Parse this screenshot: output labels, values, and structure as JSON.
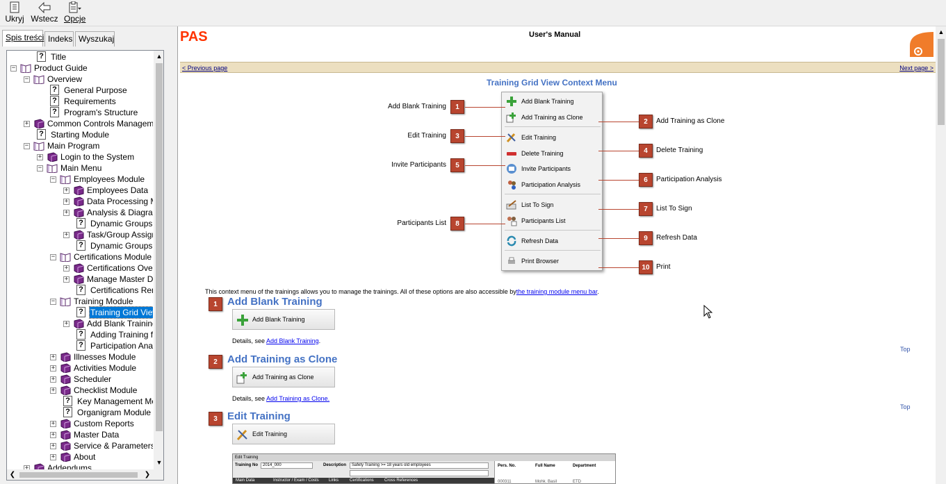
{
  "toolbar": {
    "hide_label": "Ukryj",
    "back_label": "Wstecz",
    "options_label": "Opcje"
  },
  "nav_tabs": [
    "Spis treści",
    "Indeks",
    "Wyszukaj"
  ],
  "tree": [
    {
      "label": "Title",
      "icon": "help-page-icon",
      "expander": "",
      "level": 1
    },
    {
      "label": "Product Guide",
      "icon": "open-book-icon",
      "expander": "-",
      "level": 0
    },
    {
      "label": "Overview",
      "icon": "open-book-icon",
      "expander": "-",
      "level": 1
    },
    {
      "label": "General Purpose",
      "icon": "help-page-icon",
      "expander": "",
      "level": 3
    },
    {
      "label": "Requirements",
      "icon": "help-page-icon",
      "expander": "",
      "level": 3
    },
    {
      "label": "Program's Structure",
      "icon": "help-page-icon",
      "expander": "",
      "level": 3
    },
    {
      "label": "Common Controls Management",
      "icon": "closed-book-icon",
      "expander": "+",
      "level": 1
    },
    {
      "label": "Starting Module",
      "icon": "help-page-icon",
      "expander": "",
      "level": 2
    },
    {
      "label": "Main Program",
      "icon": "open-book-icon",
      "expander": "-",
      "level": 1
    },
    {
      "label": "Login to the System",
      "icon": "closed-book-icon",
      "expander": "+",
      "level": 2
    },
    {
      "label": "Main Menu",
      "icon": "open-book-icon",
      "expander": "-",
      "level": 2
    },
    {
      "label": "Employees Module",
      "icon": "open-book-icon",
      "expander": "-",
      "level": 3
    },
    {
      "label": "Employees Data",
      "icon": "closed-book-icon",
      "expander": "+",
      "level": 4
    },
    {
      "label": "Data Processing Mo",
      "icon": "closed-book-icon",
      "expander": "+",
      "level": 4
    },
    {
      "label": "Analysis & Diagrams",
      "icon": "closed-book-icon",
      "expander": "+",
      "level": 4
    },
    {
      "label": "Dynamic Groups",
      "icon": "help-page-icon",
      "expander": "",
      "level": 5
    },
    {
      "label": "Task/Group Assign",
      "icon": "closed-book-icon",
      "expander": "+",
      "level": 4
    },
    {
      "label": "Dynamic Groups Mo",
      "icon": "help-page-icon",
      "expander": "",
      "level": 5
    },
    {
      "label": "Certifications Module",
      "icon": "open-book-icon",
      "expander": "-",
      "level": 3
    },
    {
      "label": "Certifications Overv",
      "icon": "closed-book-icon",
      "expander": "+",
      "level": 4
    },
    {
      "label": "Manage Master Dat",
      "icon": "closed-book-icon",
      "expander": "+",
      "level": 4
    },
    {
      "label": "Certifications Remin",
      "icon": "help-page-icon",
      "expander": "",
      "level": 5
    },
    {
      "label": "Training Module",
      "icon": "open-book-icon",
      "expander": "-",
      "level": 3
    },
    {
      "label": "Training Grid View C",
      "icon": "help-page-icon",
      "expander": "",
      "level": 5,
      "selected": true
    },
    {
      "label": "Add Blank Training",
      "icon": "closed-book-icon",
      "expander": "+",
      "level": 4
    },
    {
      "label": "Adding Training fron",
      "icon": "help-page-icon",
      "expander": "",
      "level": 5
    },
    {
      "label": "Participation Analys",
      "icon": "help-page-icon",
      "expander": "",
      "level": 5
    },
    {
      "label": "Illnesses Module",
      "icon": "closed-book-icon",
      "expander": "+",
      "level": 3
    },
    {
      "label": "Activities Module",
      "icon": "closed-book-icon",
      "expander": "+",
      "level": 3
    },
    {
      "label": "Scheduler",
      "icon": "closed-book-icon",
      "expander": "+",
      "level": 3
    },
    {
      "label": "Checklist Module",
      "icon": "closed-book-icon",
      "expander": "+",
      "level": 3
    },
    {
      "label": "Key Management Modu",
      "icon": "help-page-icon",
      "expander": "",
      "level": 4
    },
    {
      "label": "Organigram Module",
      "icon": "help-page-icon",
      "expander": "",
      "level": 4
    },
    {
      "label": "Custom Reports",
      "icon": "closed-book-icon",
      "expander": "+",
      "level": 3
    },
    {
      "label": "Master Data",
      "icon": "closed-book-icon",
      "expander": "+",
      "level": 3
    },
    {
      "label": "Service & Parameters",
      "icon": "closed-book-icon",
      "expander": "+",
      "level": 3
    },
    {
      "label": "About",
      "icon": "closed-book-icon",
      "expander": "+",
      "level": 3
    },
    {
      "label": "Addendums",
      "icon": "closed-book-icon",
      "expander": "+",
      "level": 1
    }
  ],
  "header": {
    "brand": "PAS",
    "manual_title": "User's Manual",
    "prev": "< Previous page",
    "next": "Next page >"
  },
  "page": {
    "title": "Training Grid View Context Menu",
    "callouts_left": [
      {
        "n": "1",
        "label": "Add Blank Training"
      },
      {
        "n": "3",
        "label": "Edit Training"
      },
      {
        "n": "5",
        "label": "Invite Participants"
      },
      {
        "n": "8",
        "label": "Participants List"
      }
    ],
    "callouts_right": [
      {
        "n": "2",
        "label": "Add Training as Clone"
      },
      {
        "n": "4",
        "label": "Delete Training"
      },
      {
        "n": "6",
        "label": "Participation Analysis"
      },
      {
        "n": "7",
        "label": "List To Sign"
      },
      {
        "n": "9",
        "label": "Refresh Data"
      },
      {
        "n": "10",
        "label": "Print"
      }
    ],
    "menu_items": [
      "Add Blank Training",
      "Add Training as Clone",
      "Edit Training",
      "Delete Training",
      "Invite Participants",
      "Participation Analysis",
      "List To Sign",
      "Participants List",
      "Refresh Data",
      "Print Browser"
    ],
    "intro": "This context menu of the trainings allows you to manage the trainings. All of these options are also accessible by",
    "intro_link": "the training module menu bar",
    "intro_end": ".",
    "details_prefix": "Details, see",
    "top_label": "Top",
    "sections": [
      {
        "n": "1",
        "title": "Add Blank Training",
        "button": "Add Blank Training",
        "link": "Add Blank Training",
        "suffix": "."
      },
      {
        "n": "2",
        "title": "Add Training as Clone",
        "button": "Add Training as Clone",
        "link": "Add Training as Clone.",
        "suffix": ""
      },
      {
        "n": "3",
        "title": "Edit Training",
        "button": "Edit Training"
      }
    ],
    "screenshot": {
      "window_title": "Edit Training",
      "training_no_label": "Training No",
      "training_no_value": "2014_000",
      "description_label": "Description",
      "description_value": "Safety Training >= 18 years old employees",
      "col_pers": "Pers. No.",
      "col_name": "Full Name",
      "col_dept": "Department",
      "tabs": [
        "Main Data",
        "Instructor / Exam / Costs",
        "Links",
        "Certifications",
        "Cross References"
      ],
      "row_pers": "000311",
      "row_name": "Mohk. Basil",
      "row_dept": "ETD"
    }
  },
  "colors": {
    "brand": "#ff3300",
    "accent": "#4472c4",
    "callout": "#b8452f",
    "selection": "#0078d7"
  }
}
